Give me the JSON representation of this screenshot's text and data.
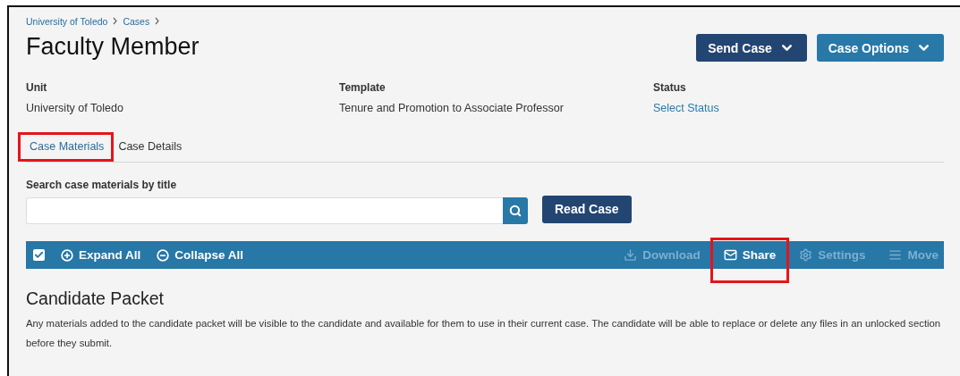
{
  "breadcrumb": [
    "University of Toledo",
    "Cases"
  ],
  "title": "Faculty Member",
  "header_buttons": [
    {
      "label": "Send Case",
      "kind": "dark"
    },
    {
      "label": "Case Options",
      "kind": "light"
    }
  ],
  "meta": [
    {
      "label": "Unit",
      "value": "University of Toledo",
      "kind": "text"
    },
    {
      "label": "Template",
      "value": "Tenure and Promotion to Associate Professor",
      "kind": "text"
    },
    {
      "label": "Status",
      "value": "Select Status",
      "kind": "link"
    }
  ],
  "tabs": [
    {
      "label": "Case Materials",
      "selected": true,
      "highlighted": true
    },
    {
      "label": "Case Details",
      "selected": false,
      "highlighted": false
    }
  ],
  "search": {
    "label": "Search case materials by title"
  },
  "read_button": "Read Case",
  "toolbar": {
    "select_all_checked": true,
    "left_actions": [
      {
        "label": "Expand All",
        "kind": "expand"
      },
      {
        "label": "Collapse All",
        "kind": "collapse"
      }
    ],
    "right_actions": [
      {
        "label": "Download",
        "kind": "download",
        "disabled": true,
        "highlighted": false
      },
      {
        "label": "Share",
        "kind": "share",
        "disabled": false,
        "highlighted": true
      },
      {
        "label": "Settings",
        "kind": "settings",
        "disabled": true,
        "highlighted": false
      },
      {
        "label": "Move",
        "kind": "move",
        "disabled": true,
        "highlighted": false
      }
    ]
  },
  "section": {
    "title": "Candidate Packet",
    "text": "Any materials added to the candidate packet will be visible to the candidate and available for them to use in their current case. The candidate will be able to replace or delete any files in an unlocked section before they submit."
  }
}
